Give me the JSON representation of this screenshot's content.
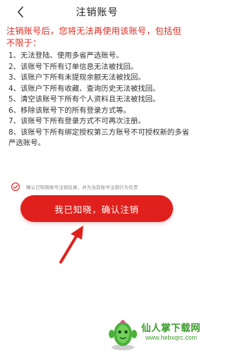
{
  "header": {
    "title": "注销账号",
    "back_icon": "chevron-left-icon"
  },
  "notice": {
    "lead": "注销账号后，您将无法再使用该账号，包括但不限于：",
    "items": [
      "1、无法登陆、使用多省严选账号。",
      "2、该账号下所有订单信息无法被找回。",
      "3、该账户下所有未提现余额无法被找回。",
      "4、该账户下所有收藏、查询历史无法被找回。",
      "5、清空该账号下所有个人资料且无法被找回。",
      "6、移除该账号下的所有登录方式等。",
      "7、该账号下所有登录方式不可再次注册。",
      "8、该账号下所有绑定授权第三方账号不可授权新的多省严选账号。"
    ]
  },
  "agreement": {
    "checked": true,
    "text": "确认已知晓账号注销后果，并为当前账号注销行为负责"
  },
  "confirm_button": {
    "label": "我已知晓，确认注销"
  },
  "watermark": {
    "name": "仙人掌下载网",
    "url": "www.hebxqrc.com"
  },
  "colors": {
    "accent": "#e0201c",
    "watermark": "#3a9b2a",
    "text": "#333333"
  }
}
